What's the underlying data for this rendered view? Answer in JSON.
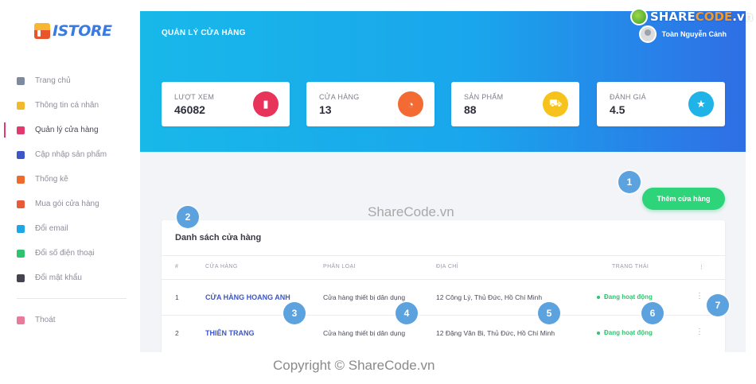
{
  "brand": {
    "logo_text": "ISTORE"
  },
  "sidebar": {
    "items": [
      {
        "label": "Trang chủ",
        "icon": "home-icon",
        "color": "#7d8ba0"
      },
      {
        "label": "Thông tin cá nhân",
        "icon": "user-icon",
        "color": "#f1b92e"
      },
      {
        "label": "Quản lý cửa hàng",
        "icon": "list-icon",
        "color": "#e23a6f",
        "active": true
      },
      {
        "label": "Cập nhập sản phẩm",
        "icon": "products-icon",
        "color": "#3d56c8"
      },
      {
        "label": "Thống kê",
        "icon": "pie-chart-icon",
        "color": "#ef6b2b"
      },
      {
        "label": "Mua gói cửa hàng",
        "icon": "cart-icon",
        "color": "#e85a3a"
      },
      {
        "label": "Đổi email",
        "icon": "mail-icon",
        "color": "#1ea7e6"
      },
      {
        "label": "Đổi số điện thoại",
        "icon": "phone-icon",
        "color": "#2ec46f"
      },
      {
        "label": "Đổi mật khẩu",
        "icon": "key-icon",
        "color": "#444450"
      }
    ],
    "logout": {
      "label": "Thoát",
      "icon": "logout-icon",
      "color": "#e87a9a"
    }
  },
  "header": {
    "title": "QUẢN LÝ CỬA HÀNG",
    "user_name": "Toàn Nguyễn Cảnh"
  },
  "stats": [
    {
      "label": "LƯỢT XEM",
      "value": "46082",
      "icon": "bar-chart-icon",
      "color": "#e8345a",
      "glyph": "▮"
    },
    {
      "label": "CỬA HÀNG",
      "value": "13",
      "icon": "pie-chart-icon",
      "color": "#f36a33",
      "glyph": "◔"
    },
    {
      "label": "SẢN PHẨM",
      "value": "88",
      "icon": "cart-icon",
      "color": "#f7c21b",
      "glyph": "⛟"
    },
    {
      "label": "ĐÁNH GIÁ",
      "value": "4.5",
      "icon": "star-icon",
      "color": "#1fb3e8",
      "glyph": "★"
    }
  ],
  "actions": {
    "add_store": "Thêm cửa hàng"
  },
  "table": {
    "title": "Danh sách cửa hàng",
    "columns": [
      "#",
      "CỬA HÀNG",
      "PHÂN LOẠI",
      "ĐỊA CHỈ",
      "TRẠNG THÁI",
      "⋮"
    ],
    "rows": [
      {
        "index": "1",
        "store": "CỬA HÀNG HOANG ANH",
        "category": "Cửa hàng thiết bị dân dụng",
        "address": "12 Công Lý, Thủ Đức, Hồ Chí Minh",
        "status": "Đang hoạt động",
        "menu": "⋮"
      },
      {
        "index": "2",
        "store": "THIÊN TRANG",
        "category": "Cửa hàng thiết bị dân dụng",
        "address": "12 Đặng Văn Bi, Thủ Đức, Hồ Chí Minh",
        "status": "Đang hoạt động",
        "menu": "⋮"
      }
    ]
  },
  "annotations": [
    "1",
    "2",
    "3",
    "4",
    "5",
    "6",
    "7"
  ],
  "watermarks": {
    "center": "ShareCode.vn",
    "bottom": "Copyright © ShareCode.vn",
    "logo_share": "SHARE",
    "logo_code": "CODE",
    "logo_tld": ".vn"
  }
}
